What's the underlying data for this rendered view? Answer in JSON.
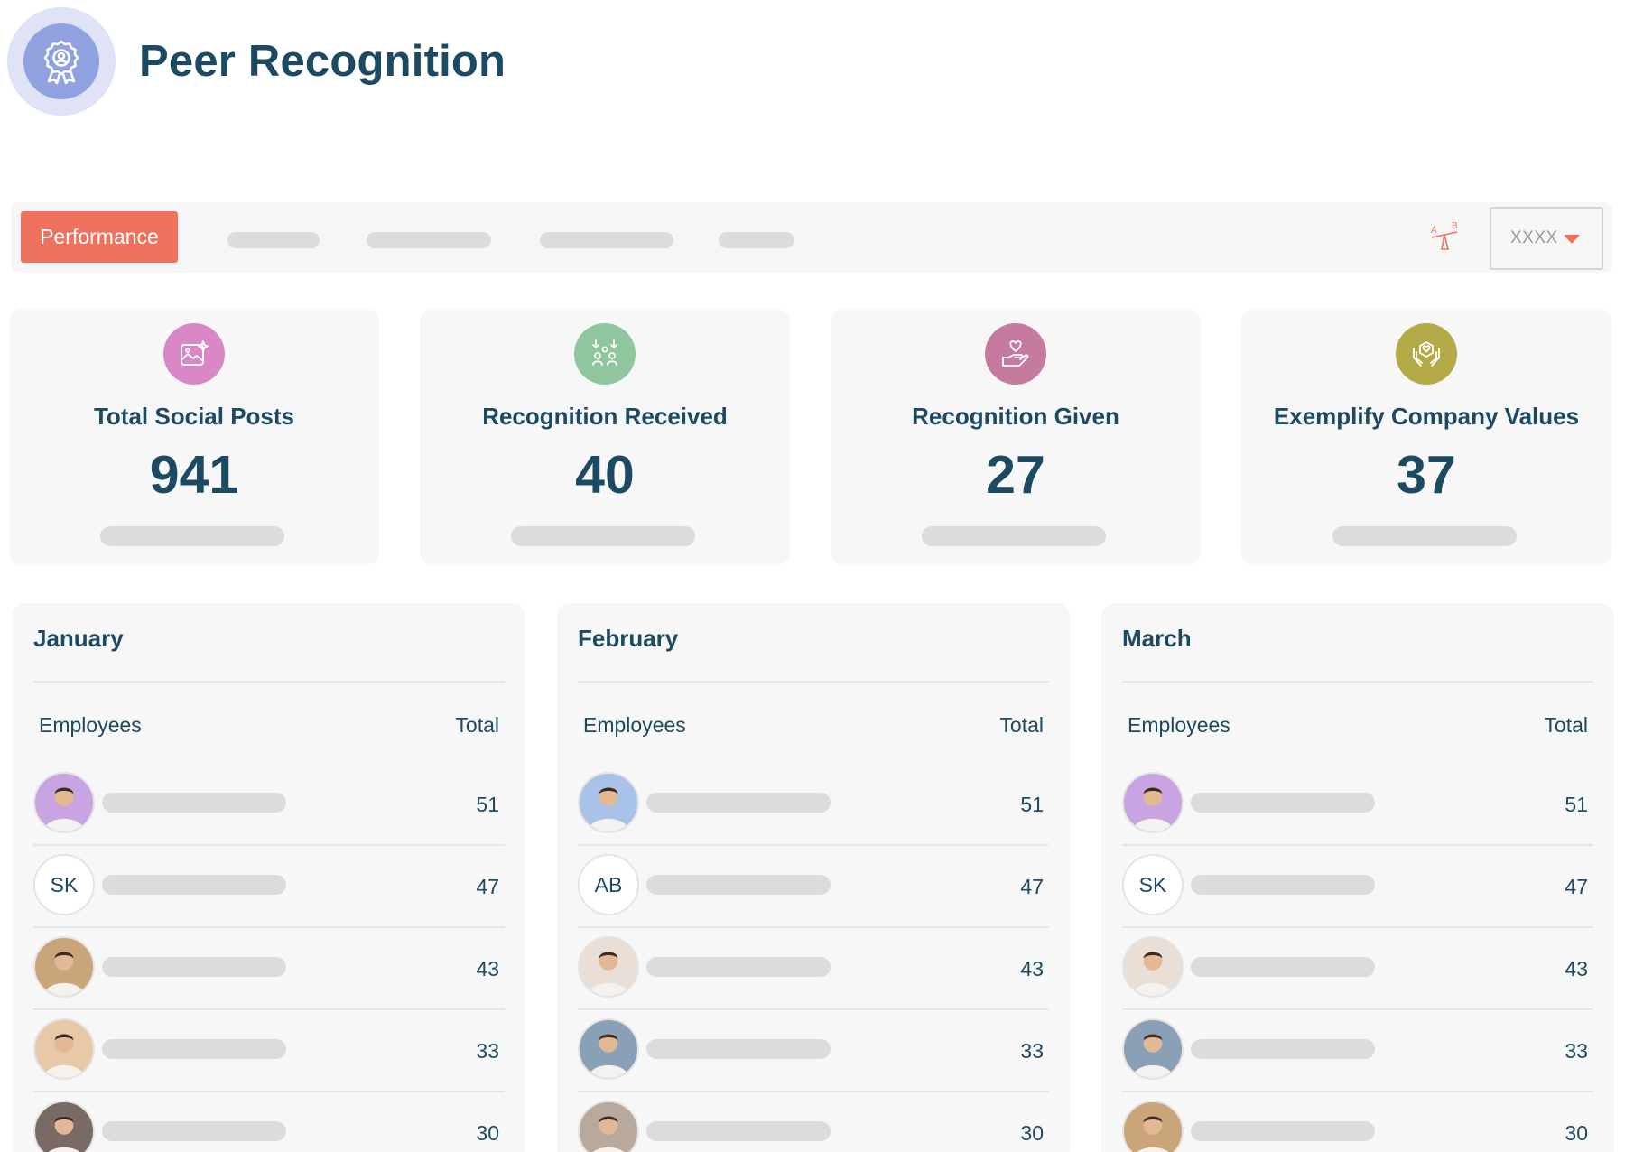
{
  "header": {
    "title": "Peer Recognition",
    "icon": "award-badge-icon"
  },
  "toolbar": {
    "active_tab": "Performance",
    "ab_icon": "ab-test-scale-icon",
    "select": {
      "value": "XXXX",
      "icon": "caret-down-icon"
    }
  },
  "stats": [
    {
      "label": "Total Social Posts",
      "value": "941",
      "icon": "image-sparkle-icon",
      "color": "#da88c5"
    },
    {
      "label": "Recognition Received",
      "value": "40",
      "icon": "people-receive-icon",
      "color": "#8fc69e"
    },
    {
      "label": "Recognition Given",
      "value": "27",
      "icon": "hand-heart-icon",
      "color": "#c67a9f"
    },
    {
      "label": "Exemplify Company Values",
      "value": "37",
      "icon": "hands-values-icon",
      "color": "#b3aa47"
    }
  ],
  "table_headers": {
    "employees": "Employees",
    "total": "Total"
  },
  "months": [
    {
      "name": "January",
      "rows": [
        {
          "initials": "",
          "avatar_color": "#c9a4e2",
          "total": "51"
        },
        {
          "initials": "SK",
          "avatar_color": "#ffffff",
          "total": "47"
        },
        {
          "initials": "",
          "avatar_color": "#caa57a",
          "total": "43"
        },
        {
          "initials": "",
          "avatar_color": "#e8c9a7",
          "total": "33"
        },
        {
          "initials": "",
          "avatar_color": "#7a6a66",
          "total": "30"
        }
      ]
    },
    {
      "name": "February",
      "rows": [
        {
          "initials": "",
          "avatar_color": "#a9c2e8",
          "total": "51"
        },
        {
          "initials": "AB",
          "avatar_color": "#ffffff",
          "total": "47"
        },
        {
          "initials": "",
          "avatar_color": "#eadfd7",
          "total": "43"
        },
        {
          "initials": "",
          "avatar_color": "#8aa0b6",
          "total": "33"
        },
        {
          "initials": "",
          "avatar_color": "#b9a89c",
          "total": "30"
        }
      ]
    },
    {
      "name": "March",
      "rows": [
        {
          "initials": "",
          "avatar_color": "#c9a4e2",
          "total": "51"
        },
        {
          "initials": "SK",
          "avatar_color": "#ffffff",
          "total": "47"
        },
        {
          "initials": "",
          "avatar_color": "#eadfd7",
          "total": "43"
        },
        {
          "initials": "",
          "avatar_color": "#8aa0b6",
          "total": "33"
        },
        {
          "initials": "",
          "avatar_color": "#caa57a",
          "total": "30"
        }
      ]
    }
  ]
}
